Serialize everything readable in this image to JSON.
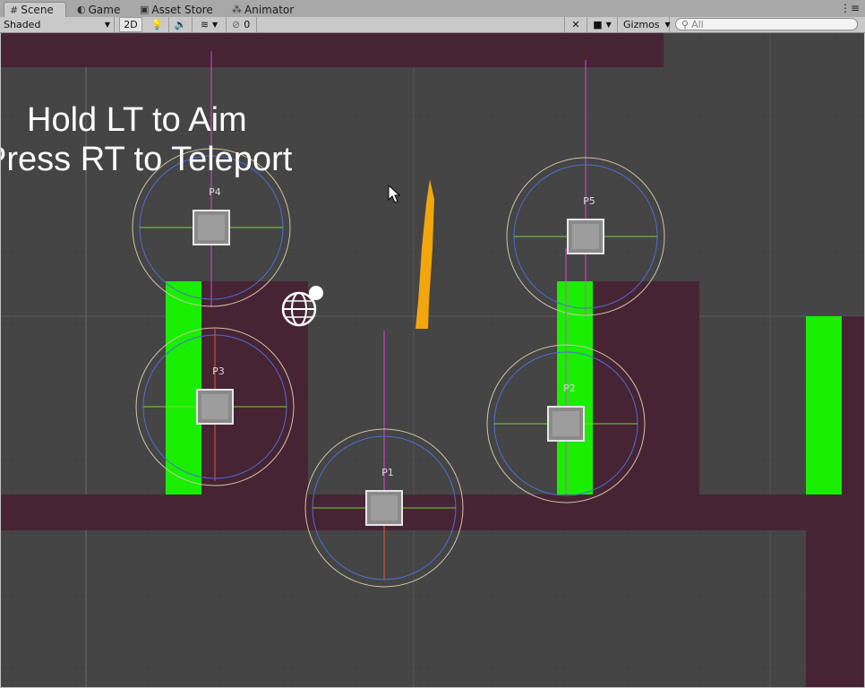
{
  "tabs": [
    {
      "label": "Scene",
      "icon": "grid-icon",
      "active": true
    },
    {
      "label": "Game",
      "icon": "pacman-icon"
    },
    {
      "label": "Asset Store",
      "icon": "bag-icon"
    },
    {
      "label": "Animator",
      "icon": "nodes-icon"
    }
  ],
  "toolbar": {
    "shading_mode": "Shaded",
    "mode_2d": "2D",
    "hidden_count": "0",
    "gizmos_label": "Gizmos",
    "search_placeholder": "All"
  },
  "scene": {
    "instruction_line1": "Hold LT to Aim",
    "instruction_line2": "Press RT to Teleport",
    "portal_labels": [
      "P1",
      "P2",
      "P3",
      "P4",
      "P5"
    ]
  },
  "colors": {
    "floor": "#462434",
    "pillar": "#19ee00",
    "background": "#444444",
    "spear": "#f2a60c"
  }
}
